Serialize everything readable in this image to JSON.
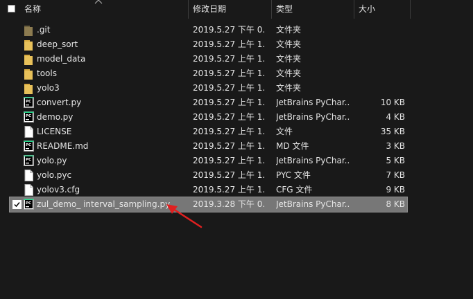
{
  "header": {
    "name": "名称",
    "date": "修改日期",
    "type": "类型",
    "size": "大小"
  },
  "files": [
    {
      "name": ".git",
      "date": "2019.5.27 下午 0...",
      "type": "文件夹",
      "size": "",
      "icon": "git-folder-icon"
    },
    {
      "name": "deep_sort",
      "date": "2019.5.27 上午 1...",
      "type": "文件夹",
      "size": "",
      "icon": "folder-icon"
    },
    {
      "name": "model_data",
      "date": "2019.5.27 上午 1...",
      "type": "文件夹",
      "size": "",
      "icon": "folder-icon"
    },
    {
      "name": "tools",
      "date": "2019.5.27 上午 1...",
      "type": "文件夹",
      "size": "",
      "icon": "folder-icon"
    },
    {
      "name": "yolo3",
      "date": "2019.5.27 上午 1...",
      "type": "文件夹",
      "size": "",
      "icon": "folder-icon"
    },
    {
      "name": "convert.py",
      "date": "2019.5.27 上午 1...",
      "type": "JetBrains PyChar...",
      "size": "10 KB",
      "icon": "pycharm-icon"
    },
    {
      "name": "demo.py",
      "date": "2019.5.27 上午 1...",
      "type": "JetBrains PyChar...",
      "size": "4 KB",
      "icon": "pycharm-icon"
    },
    {
      "name": "LICENSE",
      "date": "2019.5.27 上午 1...",
      "type": "文件",
      "size": "35 KB",
      "icon": "file-icon"
    },
    {
      "name": "README.md",
      "date": "2019.5.27 上午 1...",
      "type": "MD 文件",
      "size": "3 KB",
      "icon": "pycharm-icon"
    },
    {
      "name": "yolo.py",
      "date": "2019.5.27 上午 1...",
      "type": "JetBrains PyChar...",
      "size": "5 KB",
      "icon": "pycharm-icon"
    },
    {
      "name": "yolo.pyc",
      "date": "2019.5.27 上午 1...",
      "type": "PYC 文件",
      "size": "7 KB",
      "icon": "file-icon"
    },
    {
      "name": "yolov3.cfg",
      "date": "2019.5.27 上午 1...",
      "type": "CFG 文件",
      "size": "9 KB",
      "icon": "file-icon"
    },
    {
      "name": "zul_demo_ interval_sampling.py",
      "date": "2019.3.28 下午 0...",
      "type": "JetBrains PyChar...",
      "size": "8 KB",
      "icon": "pycharm-icon",
      "selected": true
    }
  ],
  "colors": {
    "background": "#191919",
    "selected_row": "#777777",
    "folder": "#e8c15a",
    "annotation_arrow": "#e02020"
  }
}
